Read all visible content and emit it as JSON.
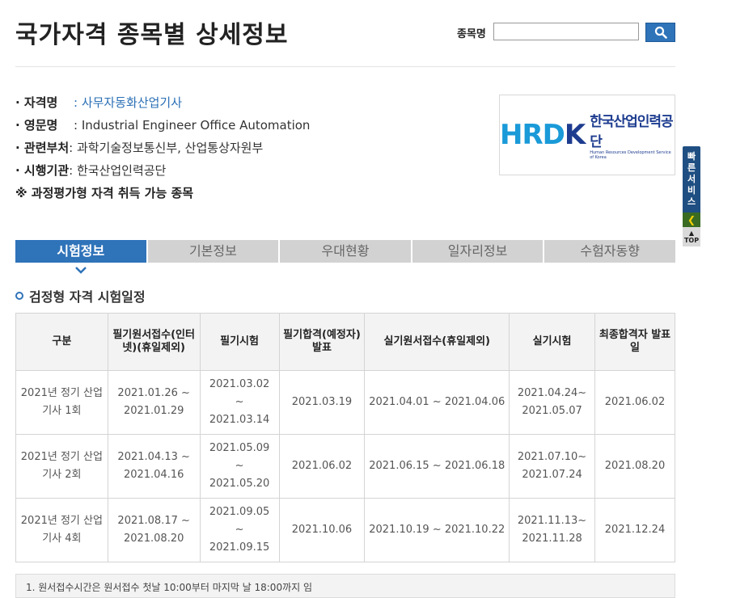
{
  "page": {
    "title": "국가자격 종목별 상세정보"
  },
  "search": {
    "label": "종목명",
    "value": "",
    "button_icon": "search-icon"
  },
  "info": {
    "rows": [
      {
        "key": "· 자격명",
        "value": ": 사무자동화산업기사"
      },
      {
        "key": "· 영문명",
        "value": ": Industrial Engineer Office Automation"
      },
      {
        "key": "· 관련부처",
        "value": ": 과학기술정보통신부, 산업통상자원부"
      },
      {
        "key": "· 시행기관",
        "value": ": 한국산업인력공단"
      }
    ],
    "note": "※ 과정평가형 자격 취득 가능 종목"
  },
  "logo": {
    "mark_a": "HRD",
    "mark_b": "K",
    "name_kr": "한국산업인력공단",
    "name_en": "Human Resources Development Service of Korea"
  },
  "quick_service": {
    "chars": [
      "빠",
      "른",
      "서",
      "비",
      "스"
    ],
    "top_label": "TOP"
  },
  "tabs": [
    {
      "label": "시험정보",
      "active": true
    },
    {
      "label": "기본정보",
      "active": false
    },
    {
      "label": "우대현황",
      "active": false
    },
    {
      "label": "일자리정보",
      "active": false
    },
    {
      "label": "수험자동향",
      "active": false
    }
  ],
  "section": {
    "title": "검정형 자격 시험일정"
  },
  "schedule": {
    "headers": [
      "구분",
      "필기원서접수(인터넷)(휴일제외)",
      "필기시험",
      "필기합격(예정자)발표",
      "실기원서접수(휴일제외)",
      "실기시험",
      "최종합격자 발표일"
    ],
    "rows": [
      [
        "2021년 정기 산업기사 1회",
        "2021.01.26 ~ 2021.01.29",
        "2021.03.02 ~ 2021.03.14",
        "2021.03.19",
        "2021.04.01 ~ 2021.04.06",
        "2021.04.24~ 2021.05.07",
        "2021.06.02"
      ],
      [
        "2021년 정기 산업기사 2회",
        "2021.04.13 ~ 2021.04.16",
        "2021.05.09 ~ 2021.05.20",
        "2021.06.02",
        "2021.06.15 ~ 2021.06.18",
        "2021.07.10~ 2021.07.24",
        "2021.08.20"
      ],
      [
        "2021년 정기 산업기사 4회",
        "2021.08.17 ~ 2021.08.20",
        "2021.09.05 ~ 2021.09.15",
        "2021.10.06",
        "2021.10.19 ~ 2021.10.22",
        "2021.11.13~ 2021.11.28",
        "2021.12.24"
      ]
    ]
  },
  "footer": {
    "note": "1. 원서접수시간은 원서접수 첫날 10:00부터 마지막 날 18:00까지 임"
  },
  "colors": {
    "accent": "#2f73b9",
    "tab_inactive": "#d2d2d2",
    "quick_service_bg": "#1f4f82"
  }
}
